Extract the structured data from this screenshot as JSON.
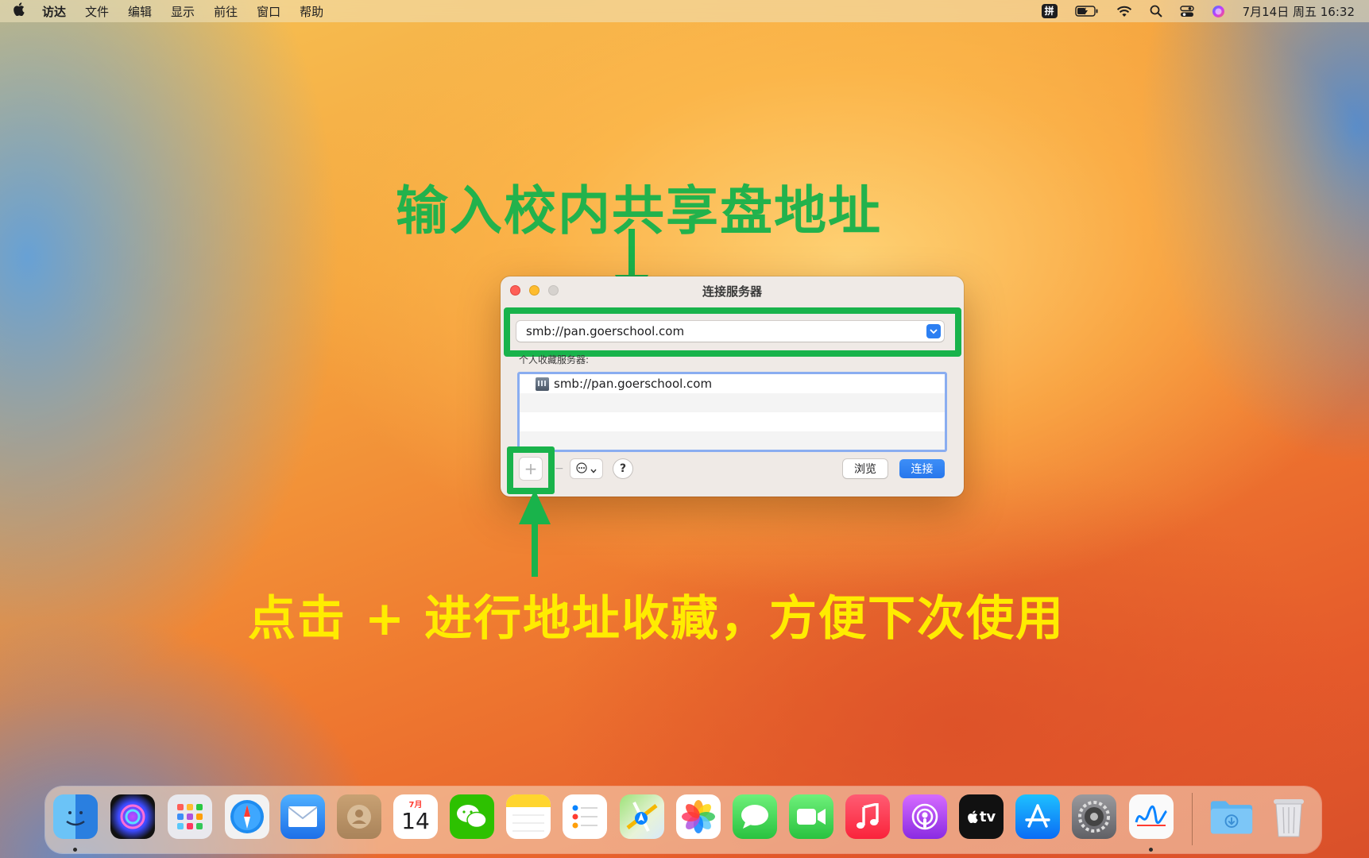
{
  "menubar": {
    "apple": "",
    "app_name": "访达",
    "items": [
      "文件",
      "编辑",
      "显示",
      "前往",
      "窗口",
      "帮助"
    ],
    "ime": "拼",
    "datetime": "7月14日 周五 16:32"
  },
  "annotation": {
    "top_text": "输入校内共享盘地址",
    "bottom_text": "点击 + 进行地址收藏，方便下次使用"
  },
  "dialog": {
    "title": "连接服务器",
    "address_value": "smb://pan.goerschool.com",
    "favorites_label": "个人收藏服务器:",
    "favorites": [
      "smb://pan.goerschool.com"
    ],
    "add_label": "+",
    "remove_label": "−",
    "more_label": "⋯",
    "help_label": "?",
    "browse_label": "浏览",
    "connect_label": "连接"
  },
  "dock": {
    "calendar_month": "7月",
    "calendar_day": "14",
    "appletv_label": "tv"
  },
  "colors": {
    "annotation_green": "#19b34b",
    "annotation_yellow": "#ffec00",
    "accent_blue": "#2c7ff2"
  }
}
